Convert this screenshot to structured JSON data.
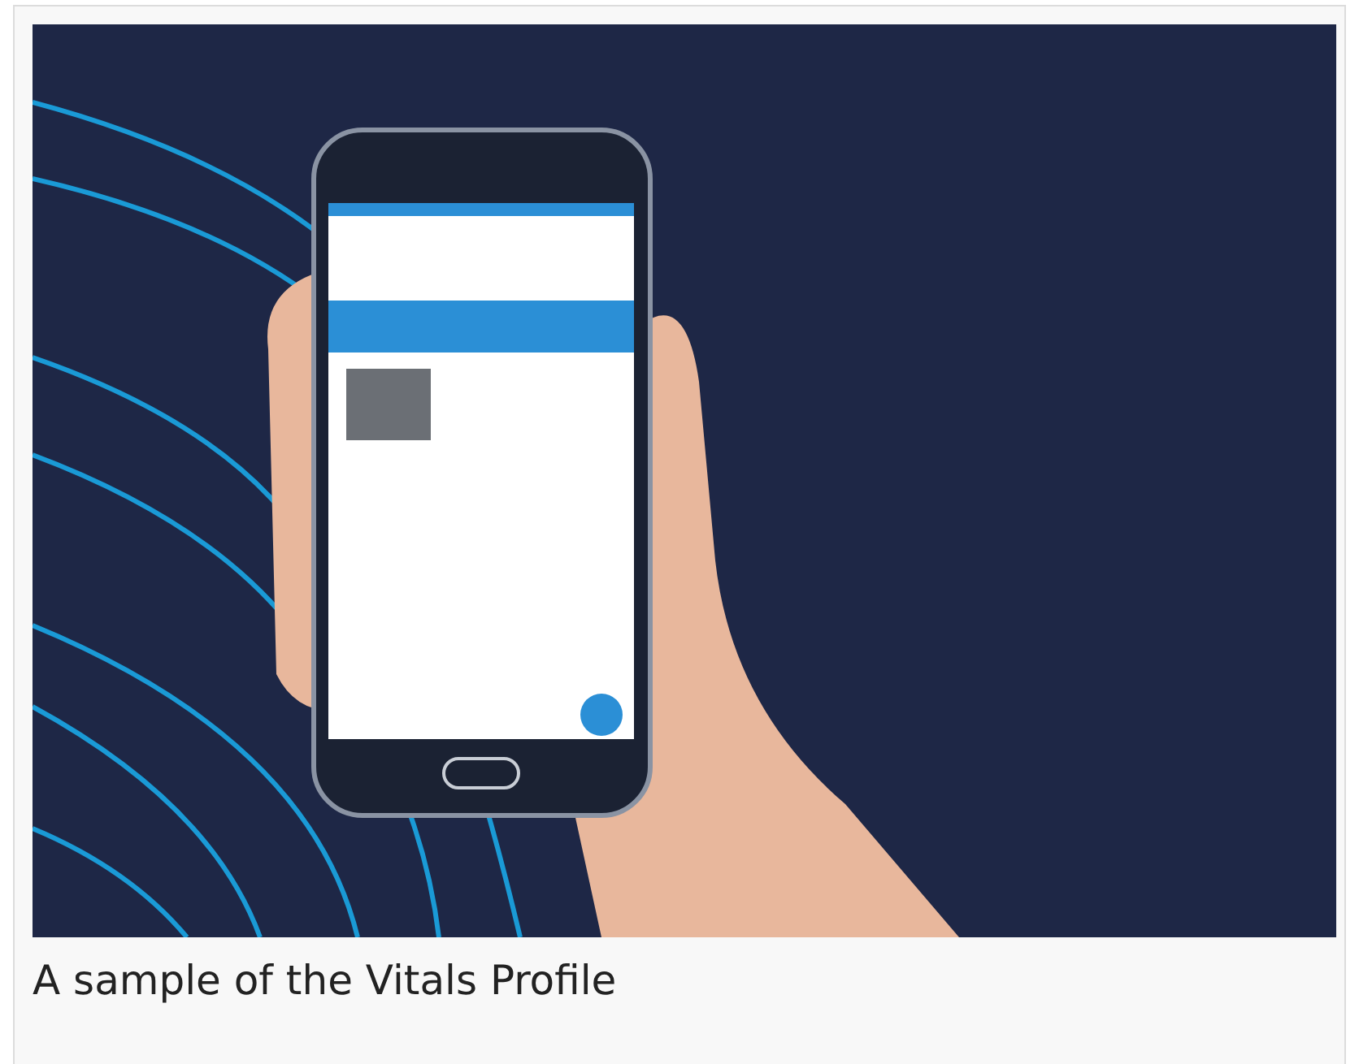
{
  "figure": {
    "caption": "A sample of the Vitals Profile"
  }
}
